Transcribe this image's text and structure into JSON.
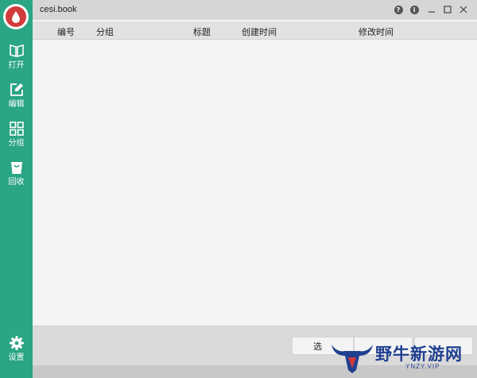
{
  "window": {
    "title": "cesi.book",
    "controls": {
      "help": "?",
      "info": "i"
    }
  },
  "sidebar": {
    "items": [
      {
        "label": "打开",
        "icon": "open-book-icon"
      },
      {
        "label": "编辑",
        "icon": "edit-icon"
      },
      {
        "label": "分组",
        "icon": "group-grid-icon"
      },
      {
        "label": "回收",
        "icon": "recycle-bin-icon"
      }
    ],
    "settings": {
      "label": "设置",
      "icon": "gear-icon"
    }
  },
  "table": {
    "columns": [
      "编号",
      "分组",
      "标题",
      "创建时间",
      "修改时间"
    ],
    "rows": []
  },
  "footer": {
    "buttons": [
      {
        "label": "选"
      }
    ]
  },
  "watermark": {
    "text": "野牛新游网",
    "subtext": "YNZY.VIP"
  },
  "colors": {
    "sidebar": "#2aa585",
    "logo": "#d23b3b",
    "watermark": "#1f3f8f"
  }
}
